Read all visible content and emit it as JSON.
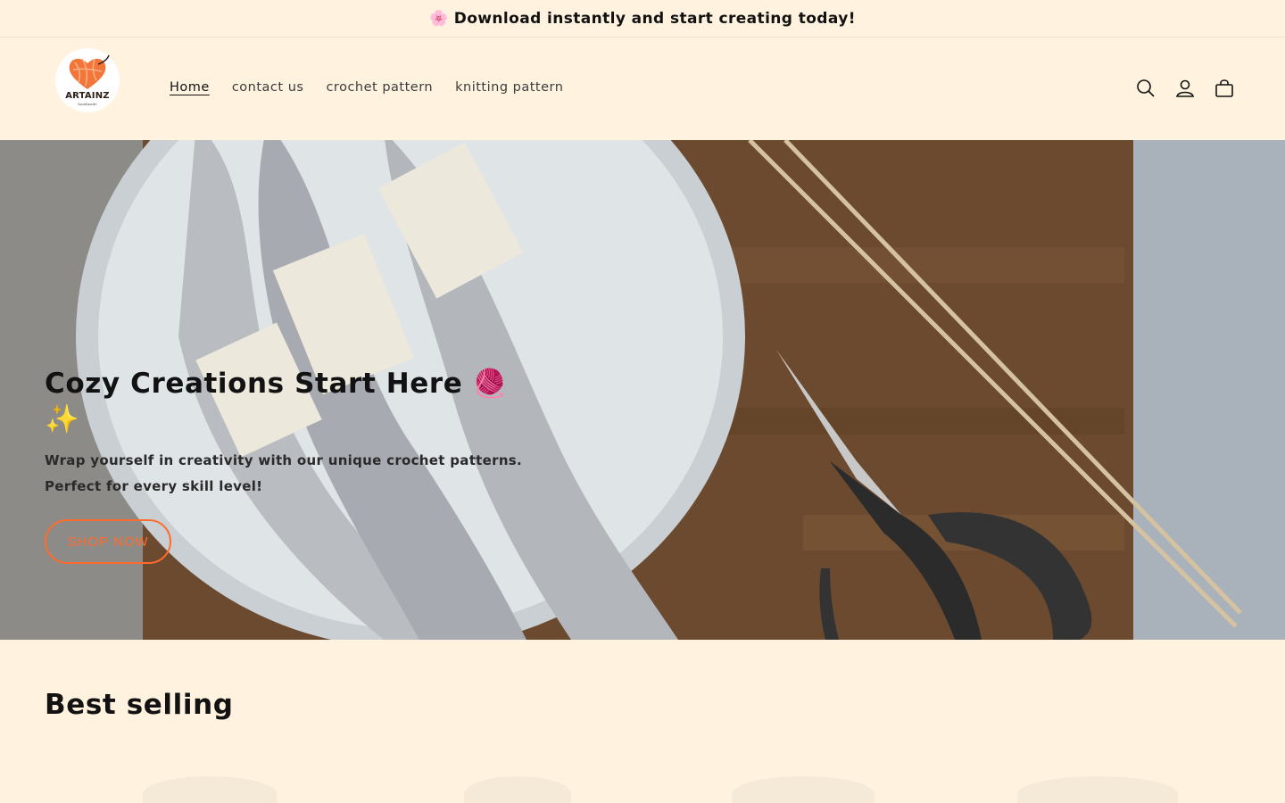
{
  "announcement": {
    "icon": "cherry-blossom-icon",
    "text": "Download instantly and start creating today!"
  },
  "header": {
    "logo": {
      "name": "ARTAINZ",
      "sub": "handmade"
    },
    "nav": [
      {
        "label": "Home",
        "active": true
      },
      {
        "label": "contact us",
        "active": false
      },
      {
        "label": "crochet pattern",
        "active": false
      },
      {
        "label": "knitting pattern",
        "active": false
      }
    ],
    "icons": [
      "search-icon",
      "account-icon",
      "cart-icon"
    ]
  },
  "hero": {
    "title": "Cozy Creations Start Here 🧶 ✨",
    "text": "Wrap yourself in creativity with our unique crochet patterns. Perfect for every skill level!",
    "button_label": "SHOP NOW"
  },
  "section": {
    "title": "Best selling"
  },
  "colors": {
    "background": "#fff3e0",
    "accent": "#ff6b2c",
    "text": "#121212"
  }
}
